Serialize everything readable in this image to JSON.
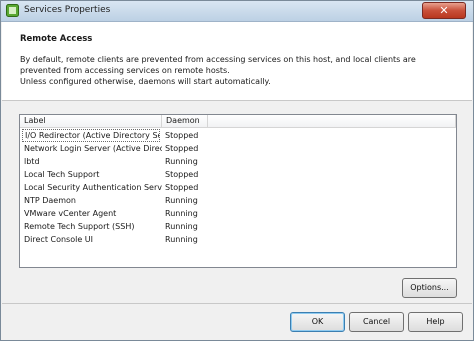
{
  "window": {
    "title": "Services Properties",
    "close_symbol": "✕"
  },
  "header": {
    "heading": "Remote Access",
    "description": "By default, remote clients are prevented from accessing services on this host, and local clients are prevented from accessing services on remote hosts.",
    "note": "Unless configured otherwise, daemons will start automatically."
  },
  "table": {
    "columns": [
      "Label",
      "Daemon"
    ],
    "rows": [
      {
        "label": "I/O Redirector (Active Directory Se...",
        "daemon": "Stopped"
      },
      {
        "label": "Network Login Server (Active Direct...",
        "daemon": "Stopped"
      },
      {
        "label": "lbtd",
        "daemon": "Running"
      },
      {
        "label": "Local Tech Support",
        "daemon": "Stopped"
      },
      {
        "label": "Local Security Authentication Serv...",
        "daemon": "Stopped"
      },
      {
        "label": "NTP Daemon",
        "daemon": "Running"
      },
      {
        "label": "VMware vCenter Agent",
        "daemon": "Running"
      },
      {
        "label": "Remote Tech Support (SSH)",
        "daemon": "Running"
      },
      {
        "label": "Direct Console UI",
        "daemon": "Running"
      }
    ],
    "selected_row": 0
  },
  "buttons": {
    "options": "Options...",
    "ok": "OK",
    "cancel": "Cancel",
    "help": "Help"
  },
  "colors": {
    "title_bar": "#c7d8ea",
    "close_button": "#c9503a",
    "app_icon": "#4a9a2a"
  },
  "icons": {
    "app": "vsphere-app-icon",
    "close": "close-icon"
  }
}
